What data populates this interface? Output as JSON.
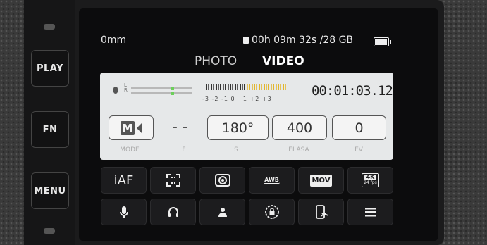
{
  "side": {
    "play": "PLAY",
    "fn": "FN",
    "menu": "MENU"
  },
  "status": {
    "focal": "0mm",
    "record_remaining": "00h 09m 32s /28 GB",
    "battery_level": 0.85
  },
  "tabs": [
    {
      "label": "PHOTO",
      "active": false
    },
    {
      "label": "VIDEO",
      "active": true
    }
  ],
  "audio": {
    "channel_top": "L",
    "channel_bottom": "R",
    "scale": "-3 -2 -1  0 +1 +2 +3"
  },
  "timecode": "00:01:03.12",
  "params": {
    "mode_letter": "M",
    "mode_label": "MODE",
    "aperture_value": "- -",
    "aperture_label": "F",
    "shutter_value": "180°",
    "shutter_label": "S",
    "iso_value": "400",
    "iso_label": "EI ASA",
    "ev_value": "0",
    "ev_label": "EV"
  },
  "grid": {
    "row1": {
      "af": "iAF",
      "awb": "AWB",
      "format": "MOV",
      "res_top": "4K",
      "res_bottom": "24 fps"
    },
    "row2": [
      "microphone-icon",
      "headphones-icon",
      "person-icon",
      "lock-icon",
      "phone-connect-icon",
      "menu-icon"
    ]
  },
  "colors": {
    "panel_bg": "#e6e8e9",
    "level_green": "#6ccf5a",
    "meter_yellow": "#e2b52a"
  }
}
